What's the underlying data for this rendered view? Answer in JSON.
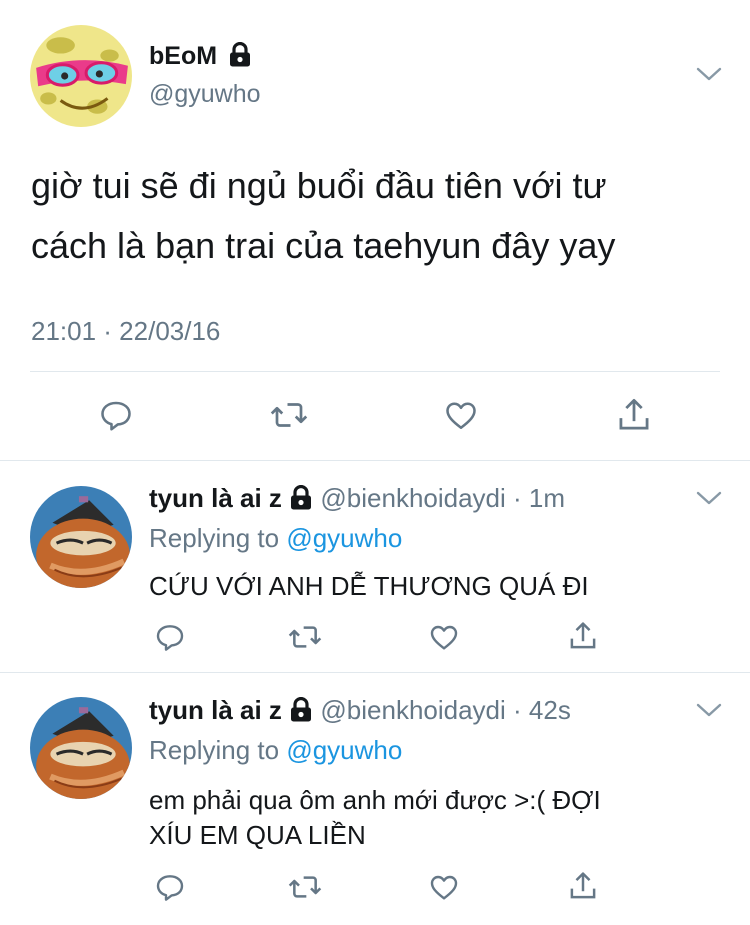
{
  "main_tweet": {
    "display_name": "bEoM",
    "handle": "@gyuwho",
    "text_line1": "giờ tui sẽ đi ngủ buổi đầu tiên với tư",
    "text_line2": "cách là bạn trai của taehyun đây yay",
    "timestamp": "21:01 · 22/03/16"
  },
  "replies": [
    {
      "display_name": "tyun là ai z",
      "handle": "@bienkhoidaydi",
      "time": "· 1m",
      "replying_prefix": "Replying to",
      "replying_to": "@gyuwho",
      "text_line1": "CỨU VỚI ANH DỄ THƯƠNG QUÁ ĐI",
      "text_line2": ""
    },
    {
      "display_name": "tyun là ai z",
      "handle": "@bienkhoidaydi",
      "time": "· 42s",
      "replying_prefix": "Replying to",
      "replying_to": "@gyuwho",
      "text_line1": "em phải qua ôm anh mới được >:( ĐỢI",
      "text_line2": "XÍU EM QUA LIỀN"
    }
  ],
  "colors": {
    "text": "#14171a",
    "secondary": "#657786",
    "link": "#1b95e0",
    "divider": "#e1e8ed"
  },
  "icons": [
    "lock-icon",
    "chevron-down-icon",
    "reply-icon",
    "retweet-icon",
    "like-icon",
    "share-icon"
  ]
}
